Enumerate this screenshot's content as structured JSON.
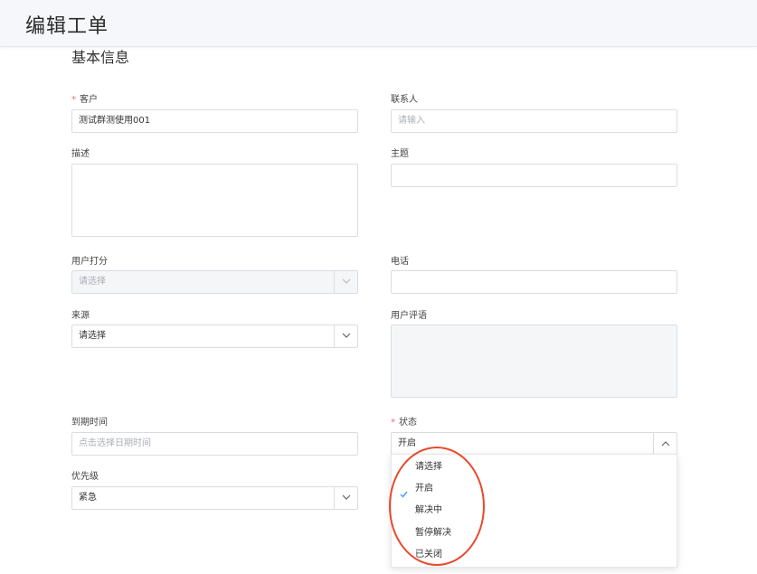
{
  "header": {
    "title": "编辑工单"
  },
  "section": {
    "title": "基本信息"
  },
  "form": {
    "customer": {
      "label": "客户",
      "value": "测试群测使用001"
    },
    "contact": {
      "label": "联系人",
      "placeholder": "请输入"
    },
    "description": {
      "label": "描述"
    },
    "subject": {
      "label": "主题"
    },
    "user_rating": {
      "label": "用户打分",
      "placeholder": "请选择"
    },
    "phone": {
      "label": "电话"
    },
    "source": {
      "label": "来源",
      "value": "请选择"
    },
    "user_comment": {
      "label": "用户评语"
    },
    "due_time": {
      "label": "到期时间",
      "placeholder": "点击选择日期时间"
    },
    "status": {
      "label": "状态",
      "value": "开启"
    },
    "priority": {
      "label": "优先级",
      "value": "紧急"
    }
  },
  "status_dropdown": {
    "options": [
      "请选择",
      "开启",
      "解决中",
      "暂停解决",
      "已关闭"
    ],
    "selected": "开启"
  },
  "colors": {
    "required": "#f56c6c",
    "check": "#409eff",
    "highlight": "#e8492c"
  }
}
